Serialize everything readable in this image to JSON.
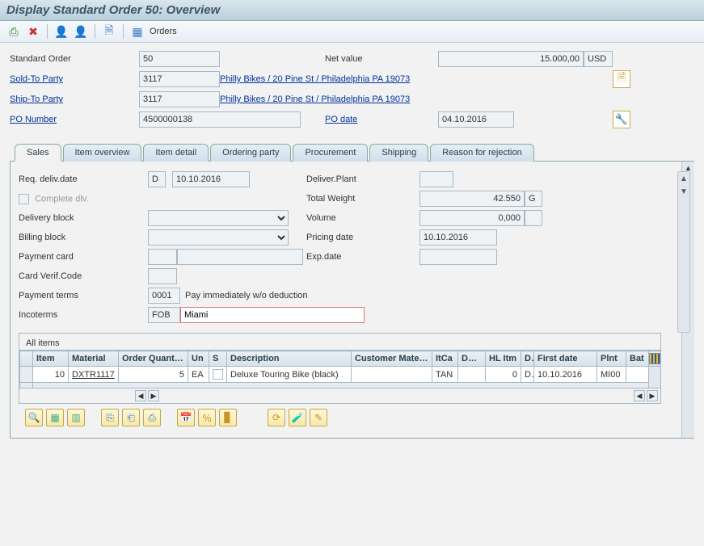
{
  "title": "Display Standard Order 50: Overview",
  "toolbar": {
    "orders_label": "Orders"
  },
  "header": {
    "std_order_label": "Standard Order",
    "std_order_value": "50",
    "net_value_label": "Net value",
    "net_value": "15.000,00",
    "currency": "USD",
    "sold_to_label": "Sold-To Party",
    "sold_to_value": "3117",
    "sold_to_text": "Philly Bikes / 20 Pine St / Philadelphia PA 19073",
    "ship_to_label": "Ship-To Party",
    "ship_to_value": "3117",
    "ship_to_text": "Philly Bikes / 20 Pine St / Philadelphia PA 19073",
    "po_number_label": "PO Number",
    "po_number_value": "4500000138",
    "po_date_label": "PO date",
    "po_date_value": "04.10.2016"
  },
  "tabs": {
    "sales": "Sales",
    "item_overview": "Item overview",
    "item_detail": "Item detail",
    "ordering_party": "Ordering party",
    "procurement": "Procurement",
    "shipping": "Shipping",
    "reason_rejection": "Reason for rejection"
  },
  "sales": {
    "req_deliv_label": "Req. deliv.date",
    "req_deliv_code": "D",
    "req_deliv_date": "10.10.2016",
    "deliver_plant_label": "Deliver.Plant",
    "deliver_plant": "",
    "complete_dlv_label": "Complete dlv.",
    "total_weight_label": "Total Weight",
    "total_weight": "42.550",
    "total_weight_unit": "G",
    "delivery_block_label": "Delivery block",
    "volume_label": "Volume",
    "volume": "0,000",
    "billing_block_label": "Billing block",
    "pricing_date_label": "Pricing date",
    "pricing_date": "10.10.2016",
    "payment_card_label": "Payment card",
    "exp_date_label": "Exp.date",
    "card_verif_label": "Card Verif.Code",
    "payment_terms_label": "Payment terms",
    "payment_terms_code": "0001",
    "payment_terms_text": "Pay immediately w/o deduction",
    "incoterms_label": "Incoterms",
    "incoterms_code": "FOB",
    "incoterms_text": "Miami"
  },
  "items_section": {
    "title": "All items",
    "cols": {
      "item": "Item",
      "material": "Material",
      "order_qty": "Order Quantity",
      "un": "Un",
      "s": "S",
      "description": "Description",
      "cust_material": "Customer Materi...",
      "itca": "ItCa",
      "dgip": "DGIP",
      "hl_itm": "HL Itm",
      "d": "D",
      "first_date": "First date",
      "plnt": "Plnt",
      "batch": "Bat"
    },
    "rows": [
      {
        "item": "10",
        "material": "DXTR1117",
        "order_qty": "5",
        "un": "EA",
        "s": "",
        "description": "Deluxe Touring Bike (black)",
        "cust_material": "",
        "itca": "TAN",
        "dgip": "",
        "hl_itm": "0",
        "d": "D",
        "first_date": "10.10.2016",
        "plnt": "MI00",
        "batch": ""
      }
    ]
  }
}
